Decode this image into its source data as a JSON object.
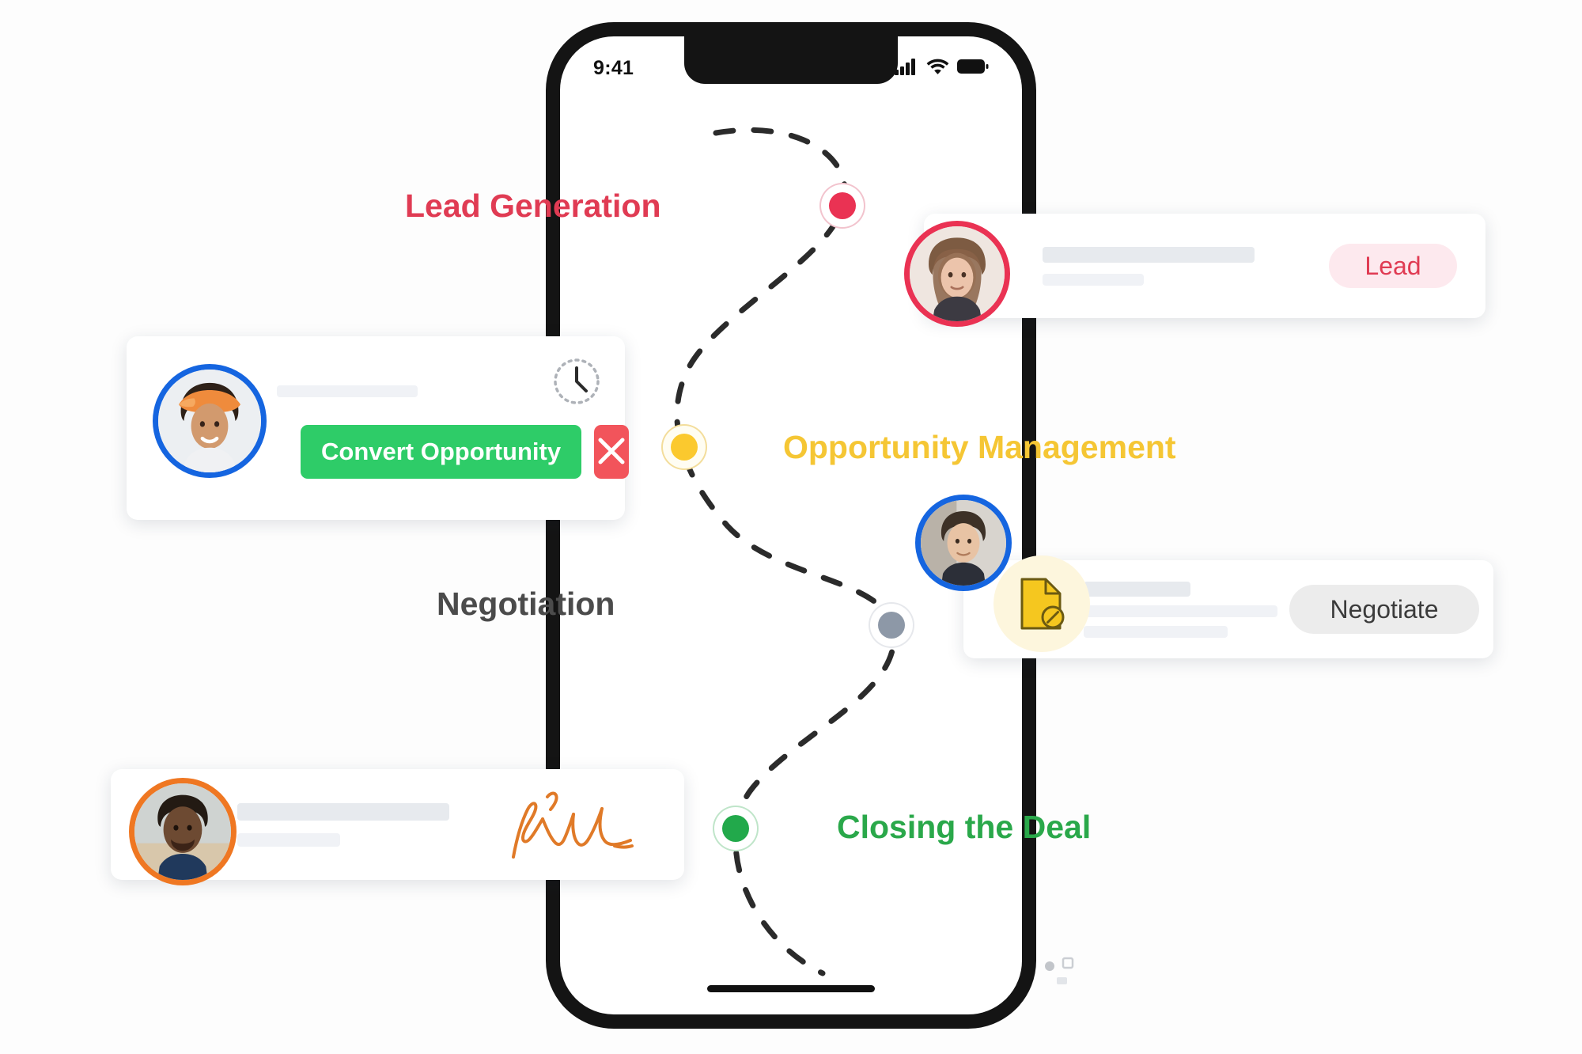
{
  "page": {
    "title": "Sales Pipeline Journey",
    "background_color": "#fdfdfd"
  },
  "phone": {
    "status_bar": {
      "time": "9:41",
      "cellular_icon": "cellular-signal-icon",
      "wifi_icon": "wifi-icon",
      "battery_icon": "battery-icon"
    },
    "home_indicator": "home-indicator"
  },
  "pipeline": {
    "path_style": "dashed-s-curve",
    "stages": [
      {
        "id": "lead-generation",
        "label": "Lead Generation",
        "color": "#e03b53",
        "dot_color": "#ea3253",
        "dot_ring": "#f2c3cd"
      },
      {
        "id": "opportunity-management",
        "label": "Opportunity Management",
        "color": "#f5c634",
        "dot_color": "#fbc92e",
        "dot_ring": "#f3dd9b"
      },
      {
        "id": "negotiation",
        "label": "Negotiation",
        "color": "#4b4b4b",
        "dot_color": "#8d98a7",
        "dot_ring": "#e6e8ec"
      },
      {
        "id": "closing-the-deal",
        "label": "Closing the Deal",
        "color": "#2aa84a",
        "dot_color": "#22a94b",
        "dot_ring": "#bfe5c9"
      }
    ]
  },
  "cards": {
    "lead": {
      "avatar": {
        "name": "avatar-woman-lead",
        "ring_color": "#ea3253"
      },
      "badge": {
        "label": "Lead",
        "text_color": "#e03b53",
        "background": "#fde9ee"
      },
      "placeholder_bars": 2
    },
    "negotiate": {
      "avatar": {
        "name": "avatar-man-negotiate",
        "ring_color": "#1565e0"
      },
      "document_icon": {
        "name": "blocked-document-icon",
        "color": "#f5c71f",
        "halo": "#fdf6dd"
      },
      "badge": {
        "label": "Negotiate",
        "text_color": "#3b3b3b",
        "background": "#ececec"
      },
      "placeholder_bars": 3
    },
    "convert": {
      "avatar": {
        "name": "avatar-woman-convert",
        "ring_color": "#1565e0"
      },
      "clock_icon": "pending-clock-icon",
      "primary_button": {
        "label": "Convert Opportunity",
        "background": "#2ecc68",
        "text_color": "#ffffff"
      },
      "dismiss_button": {
        "icon": "close-x-icon",
        "background": "#f2545b"
      },
      "placeholder_bars": 1
    },
    "signature": {
      "avatar": {
        "name": "avatar-man-signature",
        "ring_color": "#ef7722"
      },
      "signature_icon": {
        "name": "handwritten-signature",
        "color": "#e07a28"
      },
      "placeholder_bars": 2
    }
  }
}
